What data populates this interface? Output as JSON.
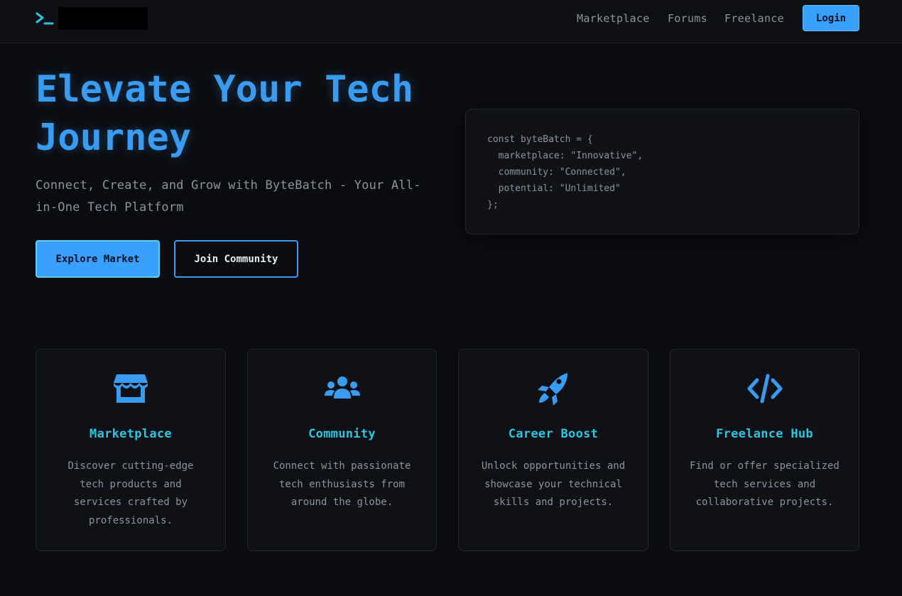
{
  "nav": {
    "links": [
      "Marketplace",
      "Forums",
      "Freelance"
    ],
    "login_label": "Login"
  },
  "hero": {
    "title": "Elevate Your Tech Journey",
    "subtitle": "Connect, Create, and Grow with ByteBatch - Your All-in-One Tech Platform",
    "primary_cta": "Explore Market",
    "secondary_cta": "Join Community"
  },
  "code": {
    "lines": [
      "const byteBatch = {",
      "  marketplace: \"Innovative\",",
      "  community: \"Connected\",",
      "  potential: \"Unlimited\"",
      "};"
    ]
  },
  "features": [
    {
      "icon": "store-icon",
      "title": "Marketplace",
      "description": "Discover cutting-edge tech products and services crafted by professionals."
    },
    {
      "icon": "users-icon",
      "title": "Community",
      "description": "Connect with passionate tech enthusiasts from around the globe."
    },
    {
      "icon": "rocket-icon",
      "title": "Career Boost",
      "description": "Unlock opportunities and showcase your technical skills and projects."
    },
    {
      "icon": "code-icon",
      "title": "Freelance Hub",
      "description": "Find or offer specialized tech services and collaborative projects."
    }
  ],
  "colors": {
    "accent": "#3a9cf0",
    "title_cyan": "#2ec5e0",
    "background": "#0b0c10"
  }
}
